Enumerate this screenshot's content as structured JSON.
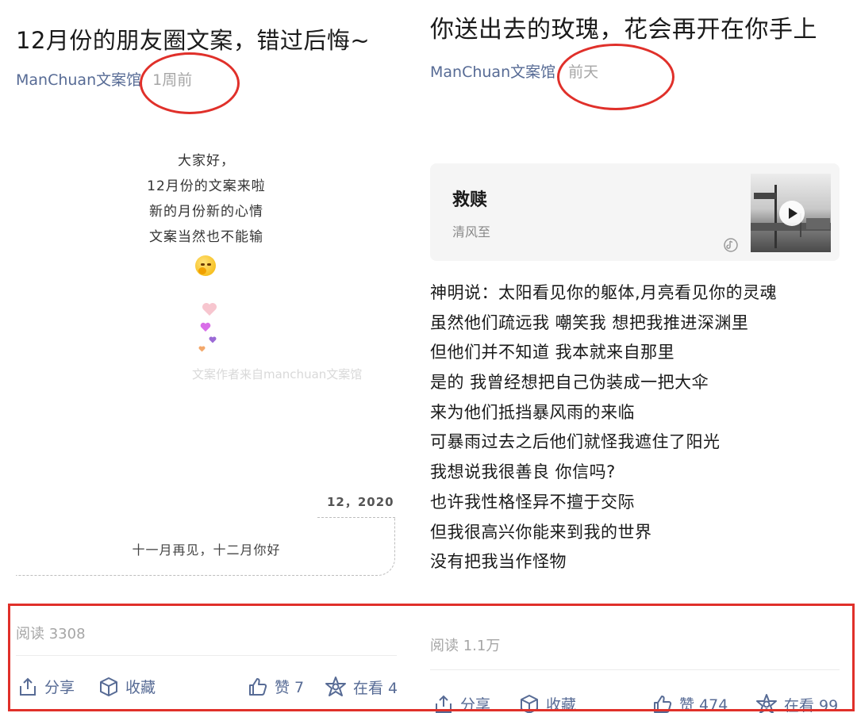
{
  "left": {
    "title": "12月份的朋友圈文案，错过后悔~",
    "author": "ManChuan文案馆",
    "time": "1周前",
    "intro_lines": [
      "大家好，",
      "12月份的文案来啦",
      "新的月份新的心情",
      "文案当然也不能输"
    ],
    "watermark": "文案作者来自manchuan文案馆",
    "date_label": "12，2020",
    "dashed_caption": "十一月再见，十二月你好",
    "read_count": "阅读 3308",
    "actions": {
      "share": "分享",
      "favorite": "收藏",
      "like": "赞 7",
      "watching": "在看 4"
    }
  },
  "right": {
    "title": "你送出去的玫瑰，花会再开在你手上",
    "author": "ManChuan文案馆",
    "time": "前天",
    "music": {
      "song": "救赎",
      "artist": "清风至",
      "icon": "music-note-icon"
    },
    "poem_lines": [
      "神明说：太阳看见你的躯体,月亮看见你的灵魂",
      "虽然他们疏远我 嘲笑我 想把我推进深渊里",
      "但他们并不知道 我本就来自那里",
      "是的 我曾经想把自己伪装成一把大伞",
      "来为他们抵挡暴风雨的来临",
      "可暴雨过去之后他们就怪我遮住了阳光",
      "我想说我很善良 你信吗?",
      "也许我性格怪异不擅于交际",
      "但我很高兴你能来到我的世界",
      "没有把我当作怪物"
    ],
    "read_count": "阅读 1.1万",
    "actions": {
      "share": "分享",
      "favorite": "收藏",
      "like": "赞 474",
      "watching": "在看 99"
    }
  },
  "colors": {
    "link": "#576b95",
    "muted": "#a6a6a6",
    "annotation_red": "#e0302a"
  }
}
